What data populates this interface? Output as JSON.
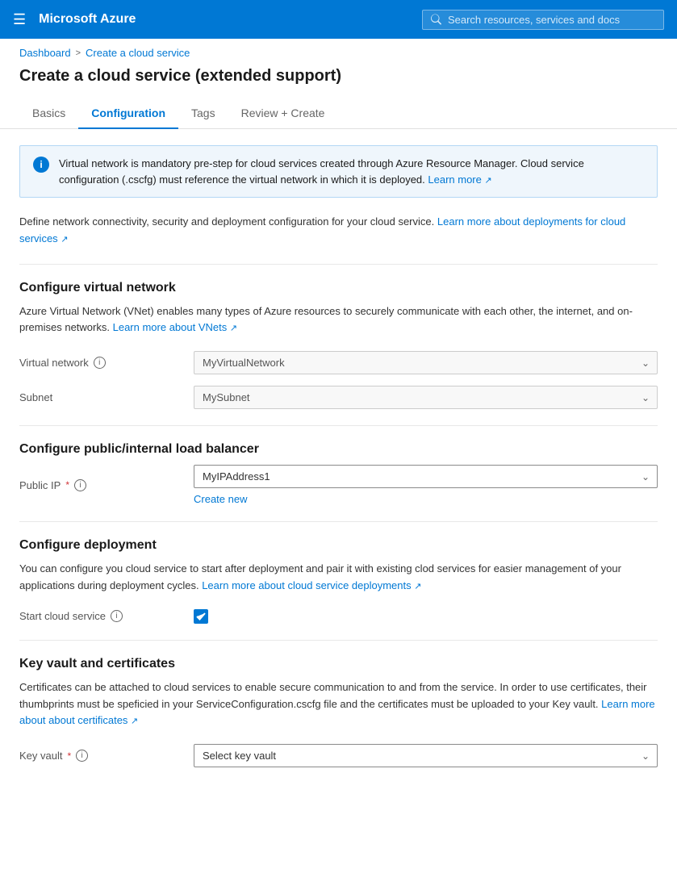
{
  "topnav": {
    "brand": "Microsoft Azure",
    "search_placeholder": "Search resources, services and docs"
  },
  "breadcrumb": {
    "home": "Dashboard",
    "current": "Create a cloud service"
  },
  "page": {
    "title": "Create a cloud service (extended support)"
  },
  "tabs": [
    {
      "id": "basics",
      "label": "Basics",
      "active": false
    },
    {
      "id": "configuration",
      "label": "Configuration",
      "active": true
    },
    {
      "id": "tags",
      "label": "Tags",
      "active": false
    },
    {
      "id": "review-create",
      "label": "Review + Create",
      "active": false
    }
  ],
  "info_banner": {
    "text": "Virtual network is mandatory pre-step for cloud services created through Azure Resource Manager. Cloud service configuration (.cscfg) must reference the virtual network in which it is deployed.",
    "link_text": "Learn more",
    "link_icon": "↗"
  },
  "section_desc": {
    "text": "Define network connectivity, security and deployment configuration for your cloud service.",
    "link_text": "Learn more about deployments for cloud services",
    "link_icon": "↗"
  },
  "vnet_section": {
    "heading": "Configure virtual network",
    "subtext": "Azure Virtual Network (VNet) enables many types of Azure resources to securely communicate with each other, the internet, and on-premises networks.",
    "vnet_link_text": "Learn more about VNets",
    "vnet_link_icon": "↗",
    "fields": [
      {
        "id": "virtual-network",
        "label": "Virtual network",
        "required": false,
        "info": true,
        "value": "MyVirtualNetwork",
        "placeholder": "MyVirtualNetwork"
      },
      {
        "id": "subnet",
        "label": "Subnet",
        "required": false,
        "info": false,
        "value": "MySubnet",
        "placeholder": "MySubnet"
      }
    ]
  },
  "lb_section": {
    "heading": "Configure public/internal load balancer",
    "fields": [
      {
        "id": "public-ip",
        "label": "Public IP",
        "required": true,
        "info": true,
        "value": "MyIPAddress1",
        "placeholder": "MyIPAddress1"
      }
    ],
    "create_new_label": "Create new"
  },
  "deployment_section": {
    "heading": "Configure deployment",
    "subtext": "You can configure you cloud service to start after deployment and pair it with existing clod services for easier management of your applications during deployment cycles.",
    "link_text": "Learn more about cloud service deployments",
    "link_icon": "↗",
    "start_cloud_service": {
      "label": "Start cloud service",
      "info": true,
      "checked": true
    }
  },
  "keyvault_section": {
    "heading": "Key vault and certificates",
    "subtext": "Certificates can be attached to cloud services to enable secure communication to and from the service. In order to use certificates, their thumbprints must be speficied in your ServiceConfiguration.cscfg file and the certificates must be uploaded to your Key vault.",
    "link_text": "Learn more about about certificates",
    "link_icon": "↗",
    "fields": [
      {
        "id": "key-vault",
        "label": "Key vault",
        "required": true,
        "info": true,
        "value": "",
        "placeholder": "Select key vault"
      }
    ]
  }
}
